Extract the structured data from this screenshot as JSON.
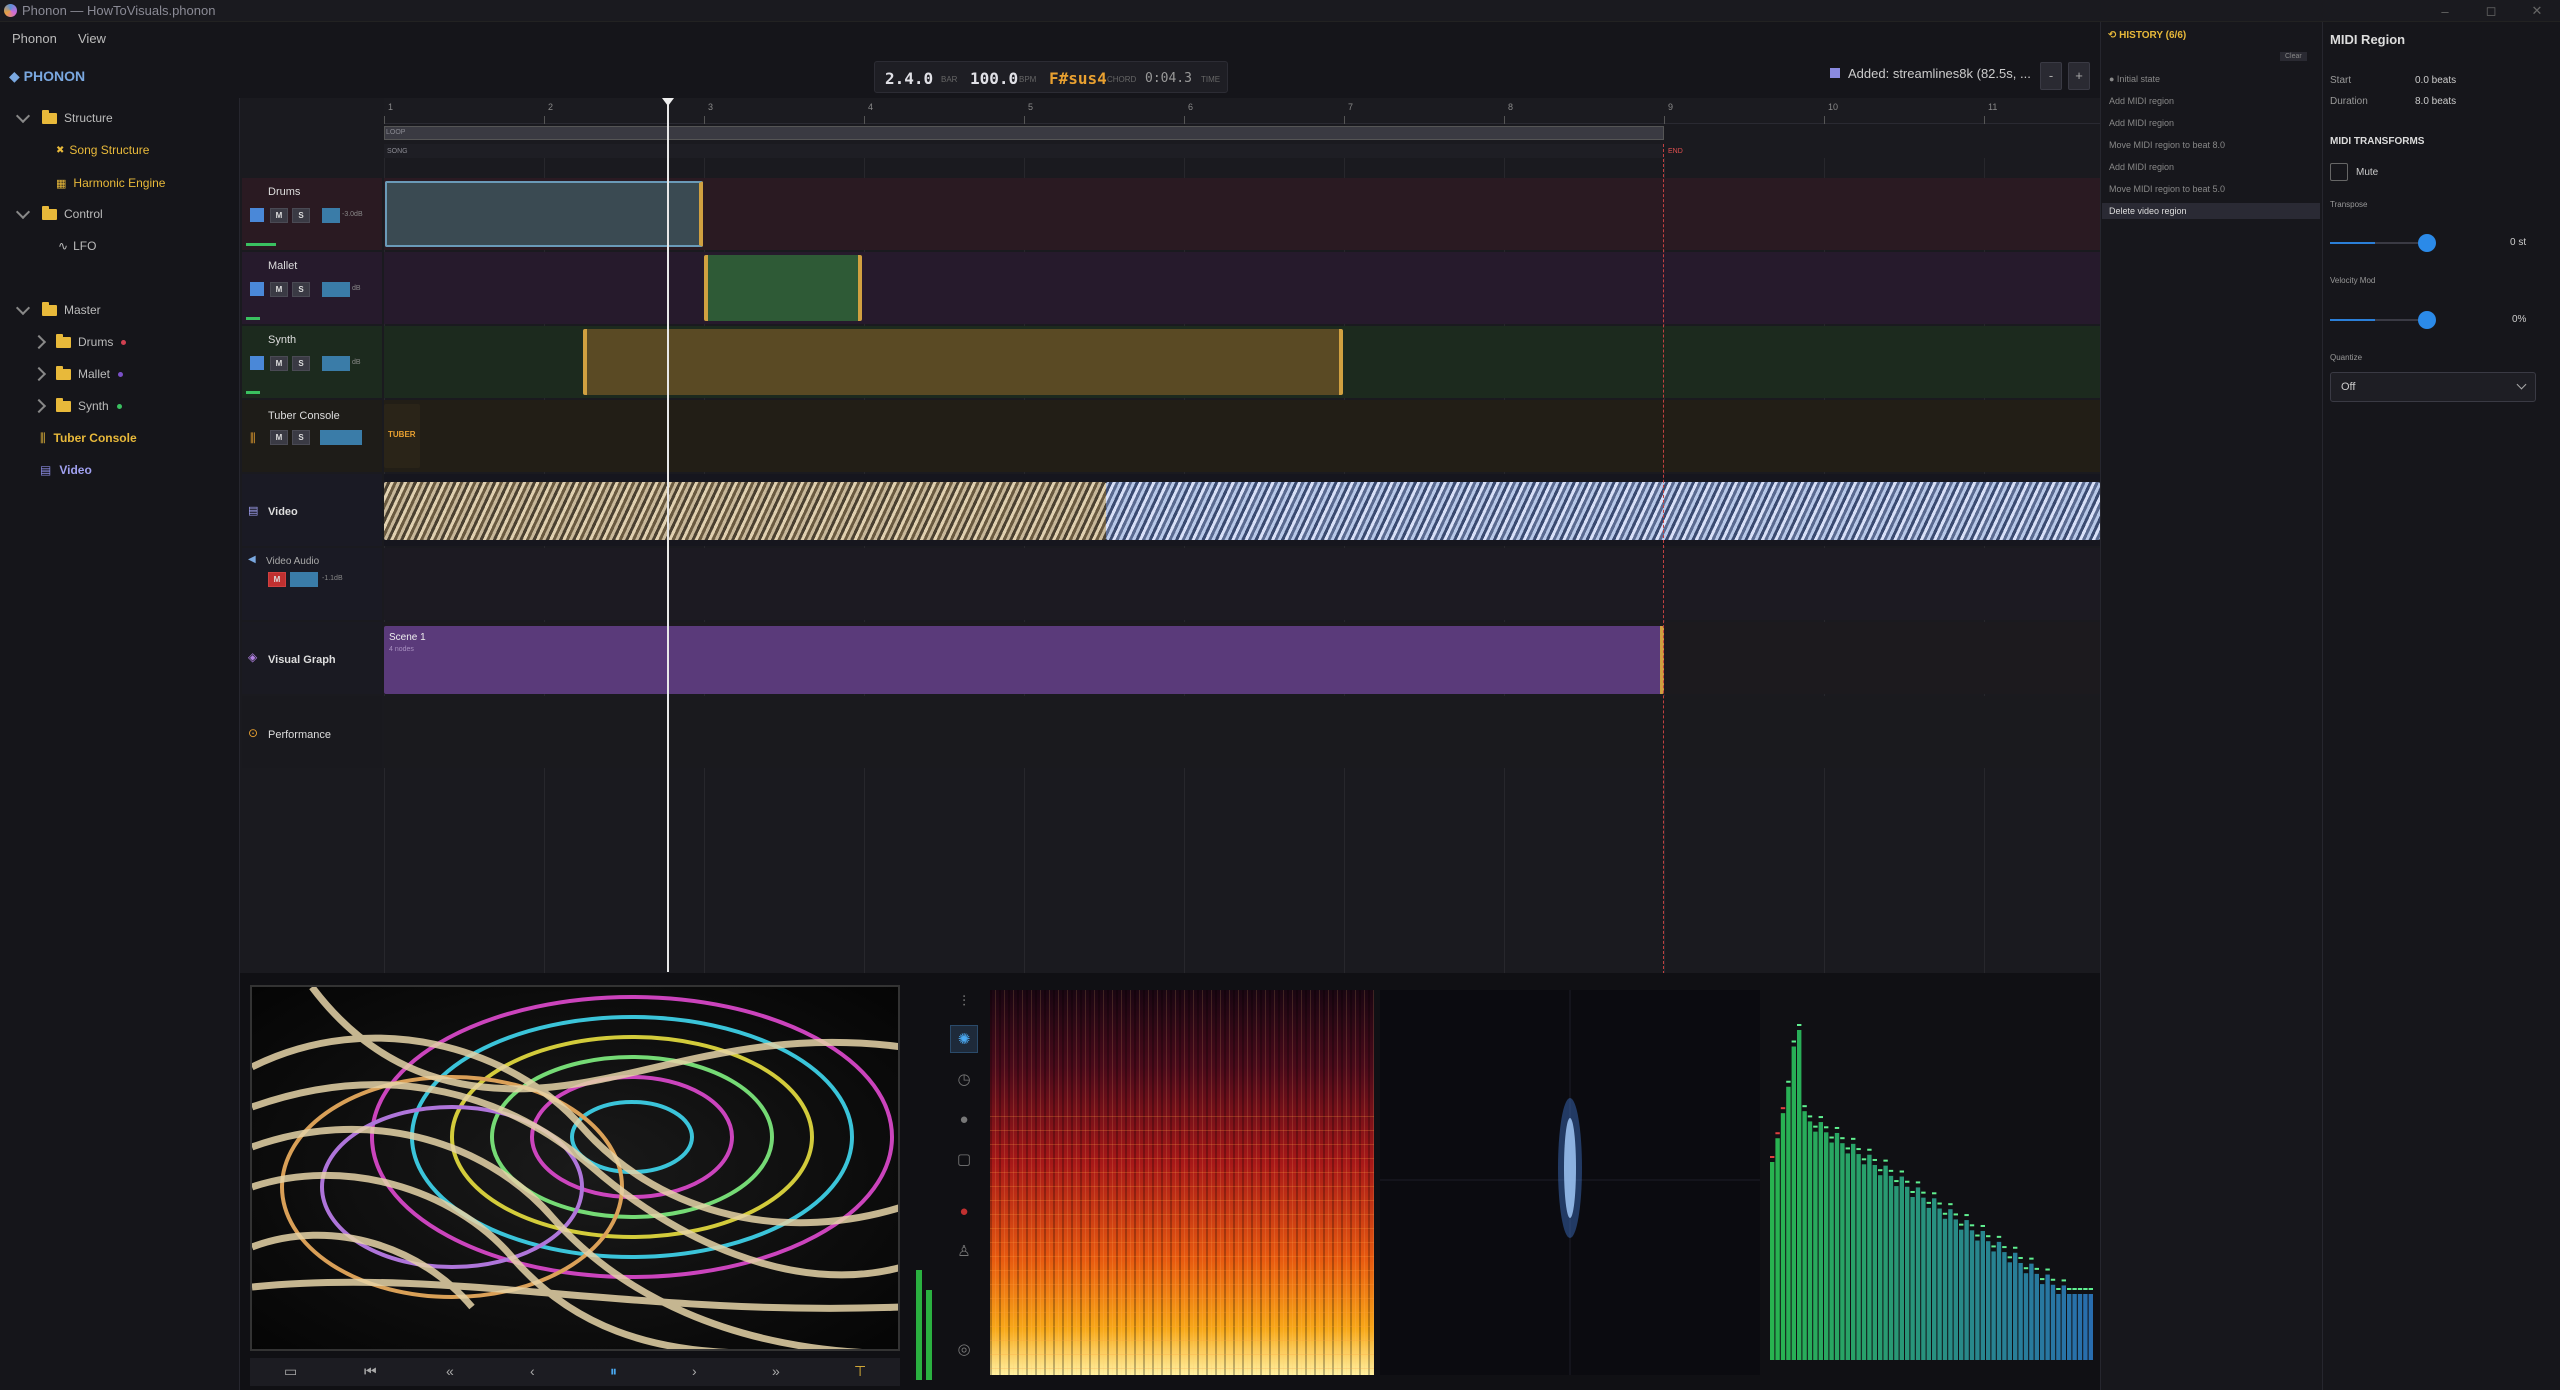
{
  "window": {
    "title": "Phonon — HowToVisuals.phonon",
    "controls": [
      "–",
      "◻",
      "✕"
    ]
  },
  "menu": [
    "Phonon",
    "View"
  ],
  "brand": "◆ PHONON",
  "sidebar": {
    "items": [
      {
        "label": "Structure",
        "kind": "folder",
        "expanded": true
      },
      {
        "label": "Song Structure",
        "kind": "child",
        "icon": "✖"
      },
      {
        "label": "Harmonic Engine",
        "kind": "child",
        "icon": "▦"
      },
      {
        "label": "Control",
        "kind": "folder",
        "expanded": true
      },
      {
        "label": "LFO",
        "kind": "child",
        "icon": "∿"
      },
      {
        "label": "Master",
        "kind": "folder",
        "expanded": true
      },
      {
        "label": "Drums",
        "kind": "subfolder",
        "dot": "#d04050"
      },
      {
        "label": "Mallet",
        "kind": "subfolder",
        "dot": "#7a50c8"
      },
      {
        "label": "Synth",
        "kind": "subfolder",
        "dot": "#3ac060"
      },
      {
        "label": "Tuber Console",
        "kind": "item",
        "icon": "⫼"
      },
      {
        "label": "Video",
        "kind": "item",
        "icon": "▤"
      }
    ]
  },
  "transport": {
    "position": "2.4.0",
    "position_unit": "BAR",
    "tempo": "100.0",
    "tempo_unit": "BPM",
    "chord": "F#sus4",
    "chord_unit": "CHORD",
    "time": "0:04.3",
    "time_unit": "TIME"
  },
  "status": {
    "added": "Added: streamlines8k (82.5s, ...",
    "zoom_out": "-",
    "zoom_in": "+"
  },
  "ruler": {
    "numbers": [
      "1",
      "2",
      "3",
      "4",
      "5",
      "6",
      "7",
      "8",
      "9",
      "10",
      "11"
    ],
    "loop_label": "LOOP",
    "song_label": "SONG",
    "end_label": "END"
  },
  "tracks": [
    {
      "name": "Drums",
      "mute": "M",
      "solo": "S",
      "db": "-3.0dB",
      "color": "#4a88d8"
    },
    {
      "name": "Mallet",
      "mute": "M",
      "solo": "S",
      "db": "dB",
      "color": "#4a88d8"
    },
    {
      "name": "Synth",
      "mute": "M",
      "solo": "S",
      "db": "dB",
      "color": "#4a88d8"
    },
    {
      "name": "Tuber Console",
      "mute": "M",
      "solo": "S",
      "region_label": "TUBER"
    },
    {
      "name": "Video"
    },
    {
      "name": "Video Audio",
      "mute": "M",
      "db": "-1.1dB"
    },
    {
      "name": "Visual Graph",
      "region_label": "Scene 1",
      "region_sub": "4 nodes"
    },
    {
      "name": "Performance"
    }
  ],
  "history": {
    "title": "HISTORY (6/6)",
    "clear": "Clear",
    "items": [
      "Initial state",
      "Add MIDI region",
      "Add MIDI region",
      "Move MIDI region to beat 8.0",
      "Add MIDI region",
      "Move MIDI region to beat 5.0",
      "Delete video region"
    ],
    "active_index": 6
  },
  "inspector": {
    "title": "MIDI Region",
    "start_label": "Start",
    "start_value": "0.0 beats",
    "duration_label": "Duration",
    "duration_value": "8.0 beats",
    "transforms_title": "MIDI TRANSFORMS",
    "mute_label": "Mute",
    "transpose_label": "Transpose",
    "transpose_value": "0 st",
    "transpose_level": 0.5,
    "velocity_label": "Velocity Mod",
    "velocity_value": "0%",
    "velocity_level": 0.5,
    "quantize_label": "Quantize",
    "quantize_value": "Off"
  },
  "playback": {
    "buttons": [
      "▭",
      "⏮",
      "«",
      "‹",
      "⏸",
      "›",
      "»",
      "⊤"
    ]
  }
}
